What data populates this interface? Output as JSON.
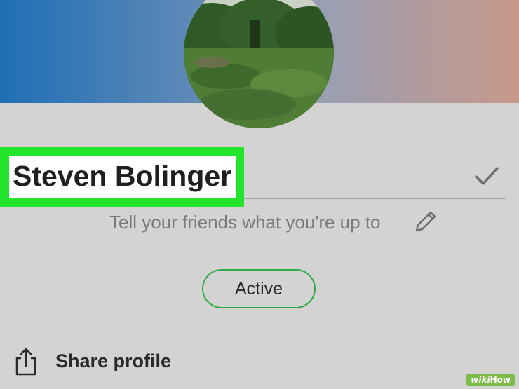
{
  "profile": {
    "name": "Steven Bolinger",
    "status_prompt": "Tell your friends what you're up to",
    "status_button_label": "Active"
  },
  "actions": {
    "share_label": "Share profile"
  },
  "icons": {
    "confirm": "checkmark-icon",
    "edit_status": "pencil-icon",
    "share": "share-icon"
  },
  "colors": {
    "highlight": "#22e52b",
    "active_border": "#2faa45",
    "background": "#d3d3d3",
    "banner_left": "#1f6fb5",
    "banner_right": "#c79889"
  },
  "watermark": {
    "part1": "wiki",
    "part2": "How"
  }
}
